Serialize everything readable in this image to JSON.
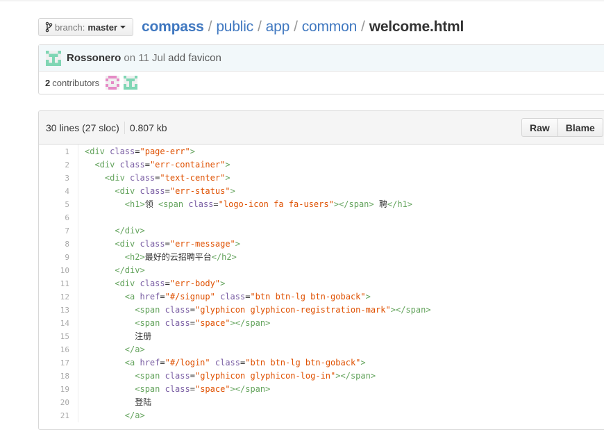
{
  "header": {
    "branch_label": "branch:",
    "branch_name": "master",
    "crumbs": [
      "compass",
      "public",
      "app",
      "common"
    ],
    "separator": "/",
    "file_name": "welcome.html"
  },
  "commit": {
    "author": "Rossonero",
    "date_text": "on 11 Jul",
    "message": "add favicon",
    "contributors_count": "2",
    "contributors_label": "contributors"
  },
  "file": {
    "lines_info": "30 lines (27 sloc)",
    "size": "0.807 kb",
    "raw_label": "Raw",
    "blame_label": "Blame"
  },
  "code": {
    "lines": [
      {
        "num": "1",
        "tokens": [
          [
            "tag",
            "<div"
          ],
          [
            "",
            ""
          ],
          [
            "attr",
            " class"
          ],
          [
            "",
            "="
          ],
          [
            "str",
            "\"page-err\""
          ],
          [
            "tag",
            ">"
          ]
        ]
      },
      {
        "num": "2",
        "tokens": [
          [
            "",
            "  "
          ],
          [
            "tag",
            "<div"
          ],
          [
            "attr",
            " class"
          ],
          [
            "",
            "="
          ],
          [
            "str",
            "\"err-container\""
          ],
          [
            "tag",
            ">"
          ]
        ]
      },
      {
        "num": "3",
        "tokens": [
          [
            "",
            "    "
          ],
          [
            "tag",
            "<div"
          ],
          [
            "attr",
            " class"
          ],
          [
            "",
            "="
          ],
          [
            "str",
            "\"text-center\""
          ],
          [
            "tag",
            ">"
          ]
        ]
      },
      {
        "num": "4",
        "tokens": [
          [
            "",
            "      "
          ],
          [
            "tag",
            "<div"
          ],
          [
            "attr",
            " class"
          ],
          [
            "",
            "="
          ],
          [
            "str",
            "\"err-status\""
          ],
          [
            "tag",
            ">"
          ]
        ]
      },
      {
        "num": "5",
        "tokens": [
          [
            "",
            "        "
          ],
          [
            "tag",
            "<h1>"
          ],
          [
            "",
            "领 "
          ],
          [
            "tag",
            "<span"
          ],
          [
            "attr",
            " class"
          ],
          [
            "",
            "="
          ],
          [
            "str",
            "\"logo-icon fa fa-users\""
          ],
          [
            "tag",
            ">"
          ],
          [
            "tag",
            "</span>"
          ],
          [
            "",
            " 聘"
          ],
          [
            "tag",
            "</h1>"
          ]
        ]
      },
      {
        "num": "6",
        "tokens": []
      },
      {
        "num": "7",
        "tokens": [
          [
            "",
            "      "
          ],
          [
            "tag",
            "</div>"
          ]
        ]
      },
      {
        "num": "8",
        "tokens": [
          [
            "",
            "      "
          ],
          [
            "tag",
            "<div"
          ],
          [
            "attr",
            " class"
          ],
          [
            "",
            "="
          ],
          [
            "str",
            "\"err-message\""
          ],
          [
            "tag",
            ">"
          ]
        ]
      },
      {
        "num": "9",
        "tokens": [
          [
            "",
            "        "
          ],
          [
            "tag",
            "<h2>"
          ],
          [
            "",
            "最好的云招聘平台"
          ],
          [
            "tag",
            "</h2>"
          ]
        ]
      },
      {
        "num": "10",
        "tokens": [
          [
            "",
            "      "
          ],
          [
            "tag",
            "</div>"
          ]
        ]
      },
      {
        "num": "11",
        "tokens": [
          [
            "",
            "      "
          ],
          [
            "tag",
            "<div"
          ],
          [
            "attr",
            " class"
          ],
          [
            "",
            "="
          ],
          [
            "str",
            "\"err-body\""
          ],
          [
            "tag",
            ">"
          ]
        ]
      },
      {
        "num": "12",
        "tokens": [
          [
            "",
            "        "
          ],
          [
            "tag",
            "<a"
          ],
          [
            "attr",
            " href"
          ],
          [
            "",
            "="
          ],
          [
            "str",
            "\"#/signup\""
          ],
          [
            "attr",
            " class"
          ],
          [
            "",
            "="
          ],
          [
            "str",
            "\"btn btn-lg btn-goback\""
          ],
          [
            "tag",
            ">"
          ]
        ]
      },
      {
        "num": "13",
        "tokens": [
          [
            "",
            "          "
          ],
          [
            "tag",
            "<span"
          ],
          [
            "attr",
            " class"
          ],
          [
            "",
            "="
          ],
          [
            "str",
            "\"glyphicon glyphicon-registration-mark\""
          ],
          [
            "tag",
            ">"
          ],
          [
            "tag",
            "</span>"
          ]
        ]
      },
      {
        "num": "14",
        "tokens": [
          [
            "",
            "          "
          ],
          [
            "tag",
            "<span"
          ],
          [
            "attr",
            " class"
          ],
          [
            "",
            "="
          ],
          [
            "str",
            "\"space\""
          ],
          [
            "tag",
            ">"
          ],
          [
            "tag",
            "</span>"
          ]
        ]
      },
      {
        "num": "15",
        "tokens": [
          [
            "",
            "          注册"
          ]
        ]
      },
      {
        "num": "16",
        "tokens": [
          [
            "",
            "        "
          ],
          [
            "tag",
            "</a>"
          ]
        ]
      },
      {
        "num": "17",
        "tokens": [
          [
            "",
            "        "
          ],
          [
            "tag",
            "<a"
          ],
          [
            "attr",
            " href"
          ],
          [
            "",
            "="
          ],
          [
            "str",
            "\"#/login\""
          ],
          [
            "attr",
            " class"
          ],
          [
            "",
            "="
          ],
          [
            "str",
            "\"btn btn-lg btn-goback\""
          ],
          [
            "tag",
            ">"
          ]
        ]
      },
      {
        "num": "18",
        "tokens": [
          [
            "",
            "          "
          ],
          [
            "tag",
            "<span"
          ],
          [
            "attr",
            " class"
          ],
          [
            "",
            "="
          ],
          [
            "str",
            "\"glyphicon glyphicon-log-in\""
          ],
          [
            "tag",
            ">"
          ],
          [
            "tag",
            "</span>"
          ]
        ]
      },
      {
        "num": "19",
        "tokens": [
          [
            "",
            "          "
          ],
          [
            "tag",
            "<span"
          ],
          [
            "attr",
            " class"
          ],
          [
            "",
            "="
          ],
          [
            "str",
            "\"space\""
          ],
          [
            "tag",
            ">"
          ],
          [
            "tag",
            "</span>"
          ]
        ]
      },
      {
        "num": "20",
        "tokens": [
          [
            "",
            "          登陆"
          ]
        ]
      },
      {
        "num": "21",
        "tokens": [
          [
            "",
            "        "
          ],
          [
            "tag",
            "</a>"
          ]
        ]
      }
    ]
  },
  "colors": {
    "link": "#4078c0",
    "tag": "#63a35c",
    "attr": "#795da3",
    "string": "#df5000",
    "commit_bg": "#f2f8fa"
  },
  "icons": {
    "branch": "branch-icon",
    "author_avatar": "identicon-green",
    "contributor_1": "identicon-pink",
    "contributor_2": "identicon-green"
  }
}
